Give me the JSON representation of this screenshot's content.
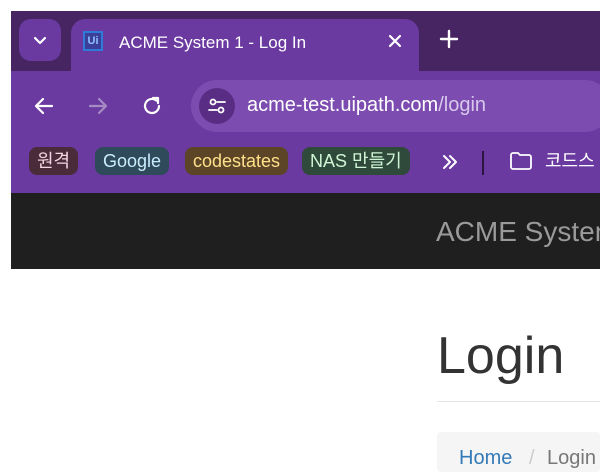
{
  "tabs": {
    "active_title": "ACME System 1 - Log In",
    "favicon_text": "Ui"
  },
  "toolbar": {
    "url_host": "acme-test.uipath.com",
    "url_path": "/login"
  },
  "bookmarks": {
    "items": [
      {
        "label": "원격",
        "bg": "#4a2b3a",
        "color": "#f1d6df"
      },
      {
        "label": "Google",
        "bg": "#2f4a5a",
        "color": "#c9ecff"
      },
      {
        "label": "codestates",
        "bg": "#5c4526",
        "color": "#ffe08a"
      },
      {
        "label": "NAS 만들기",
        "bg": "#2f4a3a",
        "color": "#d0f5d6"
      }
    ],
    "folder_label": "코드스"
  },
  "app": {
    "brand": "ACME System",
    "page_title": "Login",
    "breadcrumb_home": "Home",
    "breadcrumb_sep": "/",
    "breadcrumb_current": "Login"
  },
  "colors": {
    "tabbar": "#472563",
    "toolbar": "#6b3aa0",
    "header": "#1f1f1f"
  }
}
